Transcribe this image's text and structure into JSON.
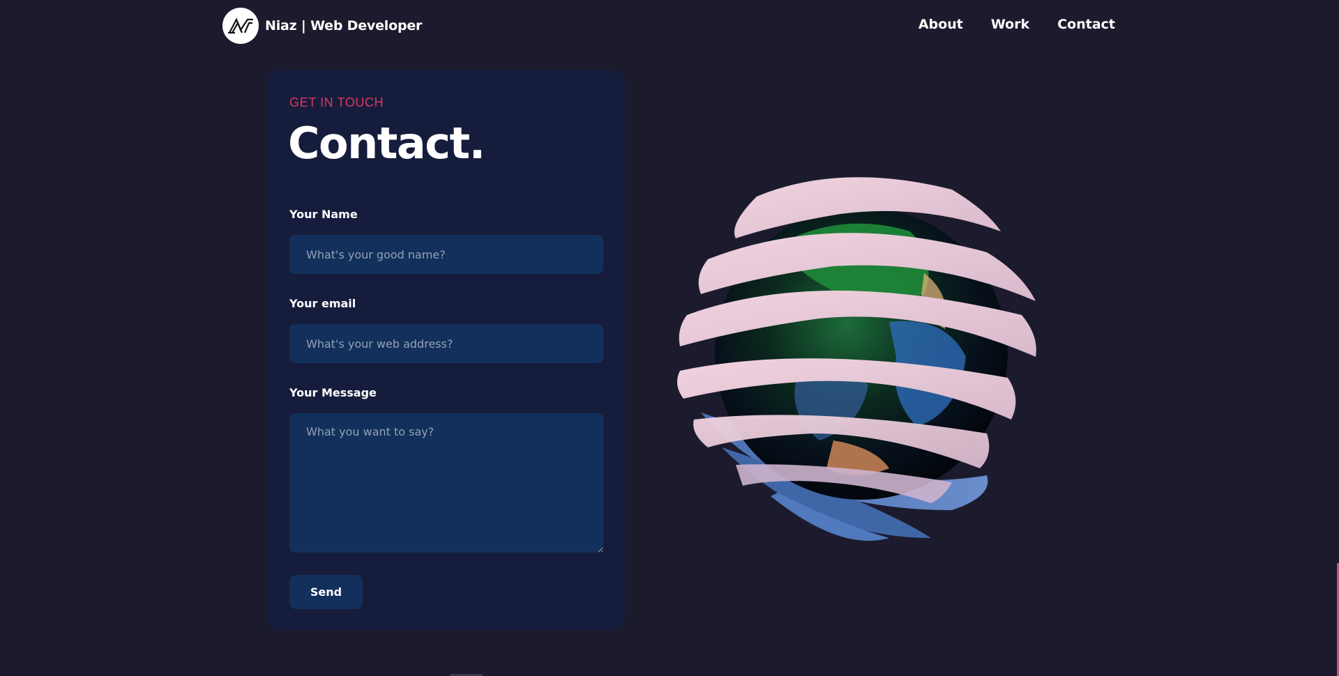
{
  "brand": {
    "name": "Niaz | Web Developer",
    "logo_icon": "nt-monogram-icon"
  },
  "nav": {
    "links": [
      {
        "label": "About"
      },
      {
        "label": "Work"
      },
      {
        "label": "Contact"
      }
    ]
  },
  "contact": {
    "eyebrow": "GET IN TOUCH",
    "title": "Contact.",
    "fields": {
      "name": {
        "label": "Your Name",
        "placeholder": "What's your good name?",
        "value": ""
      },
      "email": {
        "label": "Your email",
        "placeholder": "What's your web address?",
        "value": ""
      },
      "message": {
        "label": "Your Message",
        "placeholder": "What you want to say?",
        "value": ""
      }
    },
    "send_label": "Send"
  },
  "colors": {
    "background": "#1c1b2e",
    "card": "#161d3c",
    "input": "#12305b",
    "accent": "#e0365f"
  },
  "scene": {
    "icon": "earth-globe-3d-icon"
  }
}
